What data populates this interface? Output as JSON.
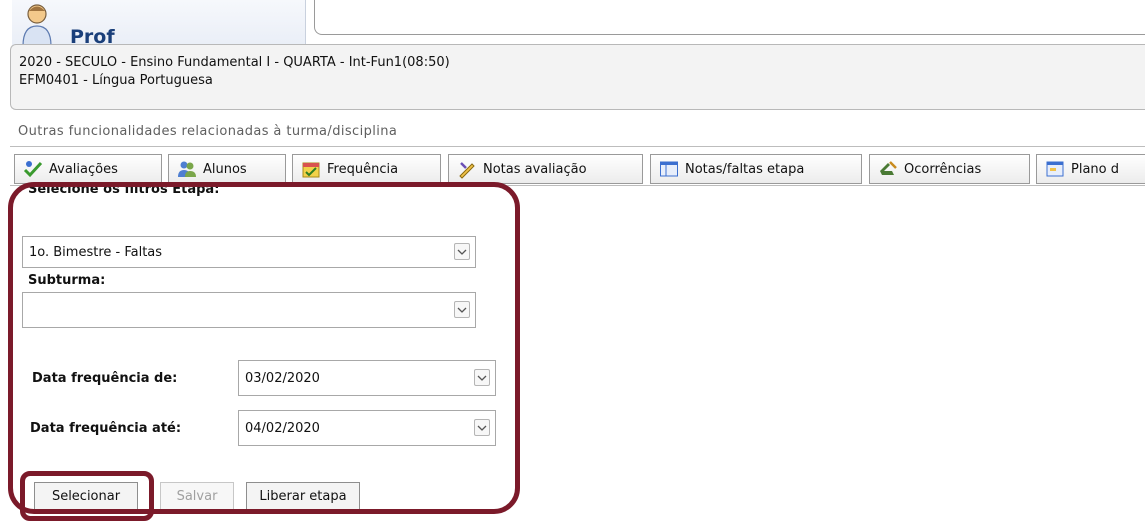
{
  "header": {
    "user_label_partial": "Prof"
  },
  "info": {
    "line1": "2020 - SECULO - Ensino Fundamental I - QUARTA - Int-Fun1(08:50)",
    "line2": "EFM0401 - Língua Portuguesa"
  },
  "section_title": "Outras funcionalidades relacionadas à turma/disciplina",
  "toolbar": {
    "buttons": [
      {
        "label": "Avaliações",
        "icon": "evaluations-icon"
      },
      {
        "label": "Alunos",
        "icon": "students-icon"
      },
      {
        "label": "Frequência",
        "icon": "attendance-icon"
      },
      {
        "label": "Notas avaliação",
        "icon": "grades-icon"
      },
      {
        "label": "Notas/faltas etapa",
        "icon": "grid-icon"
      },
      {
        "label": "Ocorrências",
        "icon": "occurrences-icon"
      },
      {
        "label": "Plano d",
        "icon": "plan-icon"
      }
    ]
  },
  "filters": {
    "heading": "Selecione os filtros Etapa:",
    "etapa_value": "1o. Bimestre - Faltas",
    "subturma_label": "Subturma:",
    "subturma_value": "",
    "date_from_label": "Data frequência de:",
    "date_from_value": "03/02/2020",
    "date_to_label": "Data frequência até:",
    "date_to_value": "04/02/2020"
  },
  "actions": {
    "select_label": "Selecionar",
    "save_label": "Salvar",
    "release_label": "Liberar etapa"
  },
  "colors": {
    "highlight": "#7b1a2a",
    "header_text": "#1a3f7a"
  }
}
